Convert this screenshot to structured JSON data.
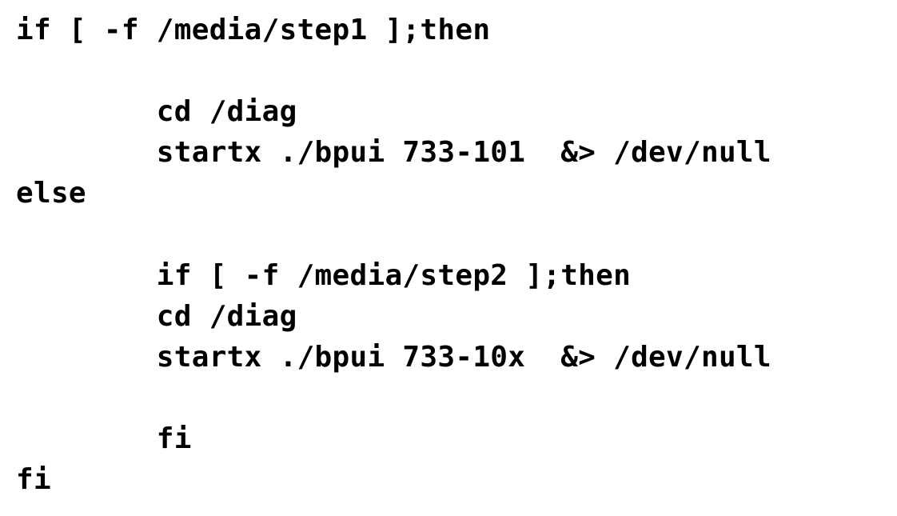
{
  "code": {
    "lines": [
      "if [ -f /media/step1 ];then",
      "",
      "        cd /diag",
      "        startx ./bpui 733-101  &> /dev/null",
      "else",
      "",
      "        if [ -f /media/step2 ];then",
      "        cd /diag",
      "        startx ./bpui 733-10x  &> /dev/null",
      "",
      "        fi",
      "fi"
    ]
  }
}
